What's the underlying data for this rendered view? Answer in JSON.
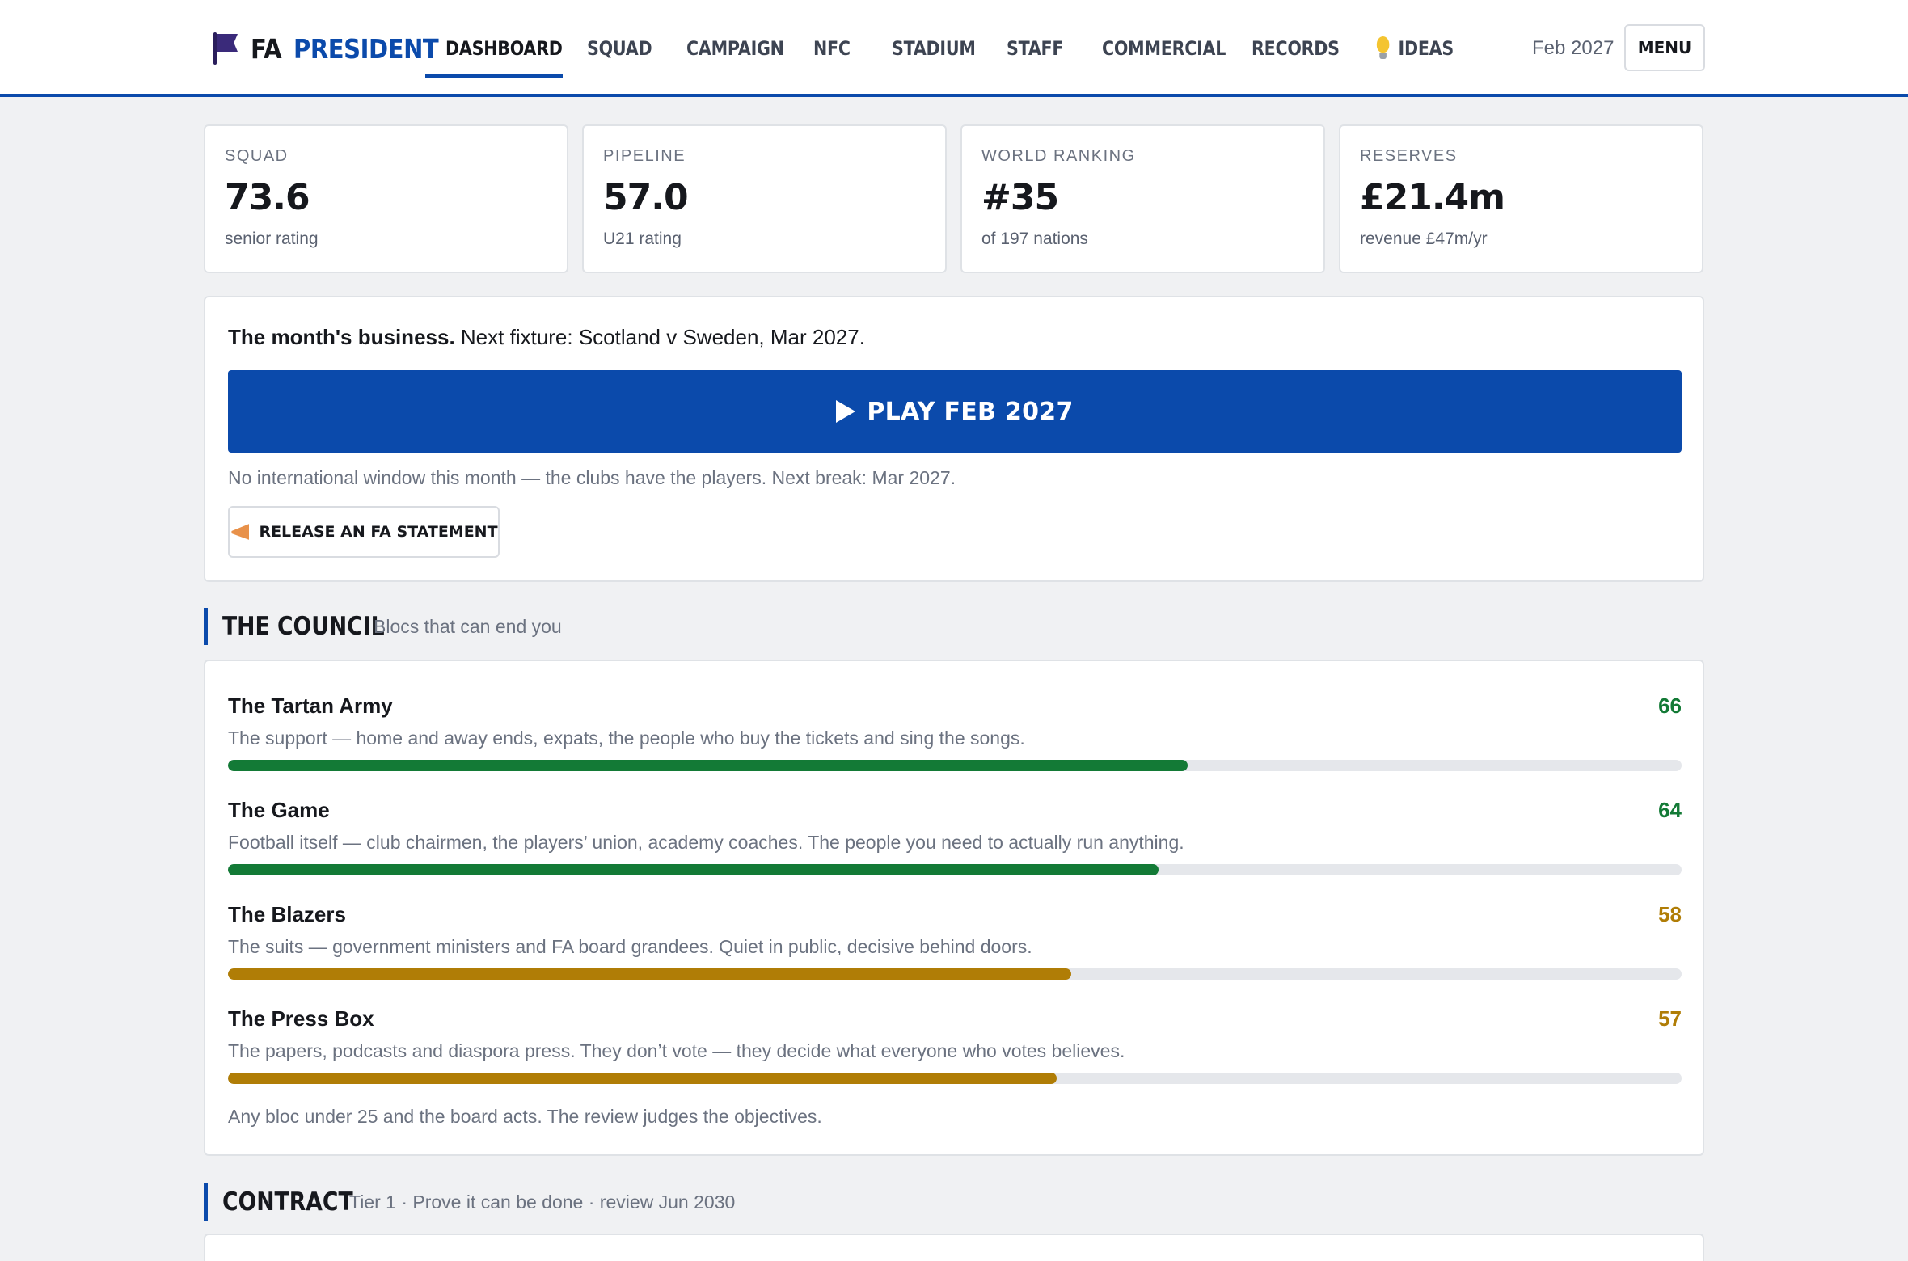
{
  "header": {
    "brand_fa": "FA",
    "brand_president": "PRESIDENT",
    "nav": [
      {
        "label": "DASHBOARD",
        "active": true
      },
      {
        "label": "SQUAD"
      },
      {
        "label": "CAMPAIGN"
      },
      {
        "label": "NFC"
      },
      {
        "label": "STADIUM"
      },
      {
        "label": "STAFF"
      },
      {
        "label": "COMMERCIAL"
      },
      {
        "label": "RECORDS"
      },
      {
        "label": "IDEAS",
        "icon": "lightbulb-icon"
      }
    ],
    "date": "Feb 2027",
    "menu_label": "MENU"
  },
  "stats": [
    {
      "label": "SQUAD",
      "value": "73.6",
      "sub": "senior rating"
    },
    {
      "label": "PIPELINE",
      "value": "57.0",
      "sub": "U21 rating"
    },
    {
      "label": "WORLD RANKING",
      "value": "#35",
      "sub": "of 197 nations"
    },
    {
      "label": "RESERVES",
      "value": "£21.4m",
      "sub": "revenue £47m/yr"
    }
  ],
  "business": {
    "title": "The month's business.",
    "fixture": "Next fixture: Scotland v Sweden, Mar 2027.",
    "play_label": "PLAY FEB 2027",
    "note": "No international window this month — the clubs have the players. Next break: Mar 2027.",
    "statement_label": "RELEASE AN FA STATEMENT"
  },
  "council": {
    "title": "THE COUNCIL",
    "subtitle": "Blocs that can end you",
    "blocs": [
      {
        "name": "The Tartan Army",
        "score": "66",
        "fill": 0.66,
        "color": "#137a36",
        "desc": "The support — home and away ends, expats, the people who buy the tickets and sing the songs."
      },
      {
        "name": "The Game",
        "score": "64",
        "fill": 0.64,
        "color": "#137a36",
        "desc": "Football itself — club chairmen, the players’ union, academy coaches. The people you need to actually run anything."
      },
      {
        "name": "The Blazers",
        "score": "58",
        "fill": 0.58,
        "color": "#b07d06",
        "desc": "The suits — government ministers and FA board grandees. Quiet in public, decisive behind doors."
      },
      {
        "name": "The Press Box",
        "score": "57",
        "fill": 0.57,
        "color": "#b07d06",
        "desc": "The papers, podcasts and diaspora press. They don’t vote — they decide what everyone who votes believes."
      }
    ],
    "note": "Any bloc under 25 and the board acts. The review judges the objectives."
  },
  "contract": {
    "title": "CONTRACT",
    "subtitle": "Tier 1 · Prove it can be done · review Jun 2030"
  },
  "colors": {
    "accent": "#0b4aab",
    "good": "#137a36",
    "warn": "#b07d06"
  }
}
